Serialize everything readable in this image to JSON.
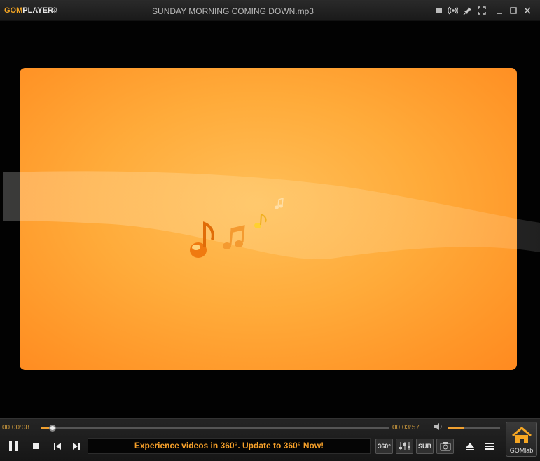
{
  "titlebar": {
    "logo_gom": "GOM",
    "logo_player": "PLAYER",
    "title": "SUNDAY MORNING COMING DOWN.mp3"
  },
  "icons": {
    "settings": "gear-icon",
    "audio": "broadcast-icon",
    "pin": "pin-icon",
    "fullscreen": "fullscreen-icon",
    "minimize": "minimize-icon",
    "maximize": "maximize-icon",
    "close": "close-icon"
  },
  "player": {
    "elapsed": "00:00:08",
    "duration": "00:03:57",
    "progress_fraction": 0.034,
    "volume_fraction": 0.3
  },
  "banner": {
    "text": "Experience videos in 360°. Update to 360° Now!"
  },
  "buttons": {
    "vr360": "360°",
    "sub": "SUB",
    "gomlab": "GOMlab"
  },
  "colors": {
    "accent": "#f5a623",
    "art_background": "#ffab3a",
    "time_text": "#c9973d"
  }
}
